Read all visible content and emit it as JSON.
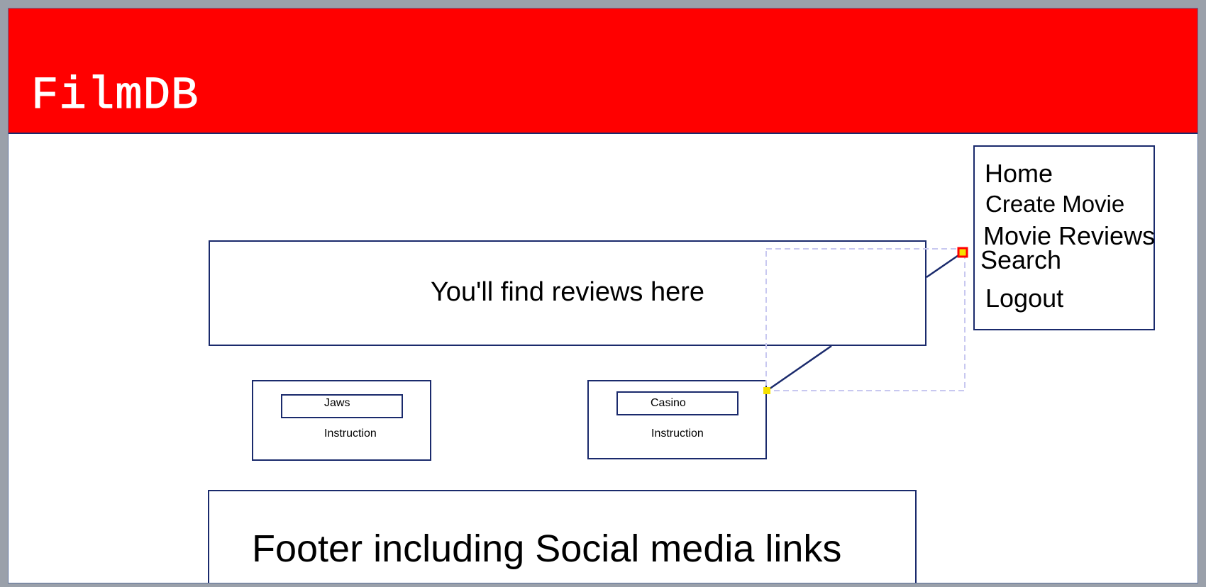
{
  "header": {
    "brand": "FilmDB",
    "background_color": "#ff0000",
    "brand_color": "#ffffff"
  },
  "nav": {
    "items": [
      {
        "label": "Home"
      },
      {
        "label": "Create Movie"
      },
      {
        "label": "Movie Reviews"
      },
      {
        "label": "Search"
      },
      {
        "label": "Logout"
      }
    ]
  },
  "hero": {
    "text": "You'll find reviews here"
  },
  "cards": [
    {
      "title": "Jaws",
      "description": "Instruction"
    },
    {
      "title": "Casino",
      "description": "Instruction"
    }
  ],
  "footer": {
    "text": "Footer including Social media links"
  },
  "colors": {
    "border": "#1a2a6c",
    "connector_handle": "#ff0000",
    "handle_fill": "#f5e000",
    "selection_dash": "#c8c8f0"
  }
}
